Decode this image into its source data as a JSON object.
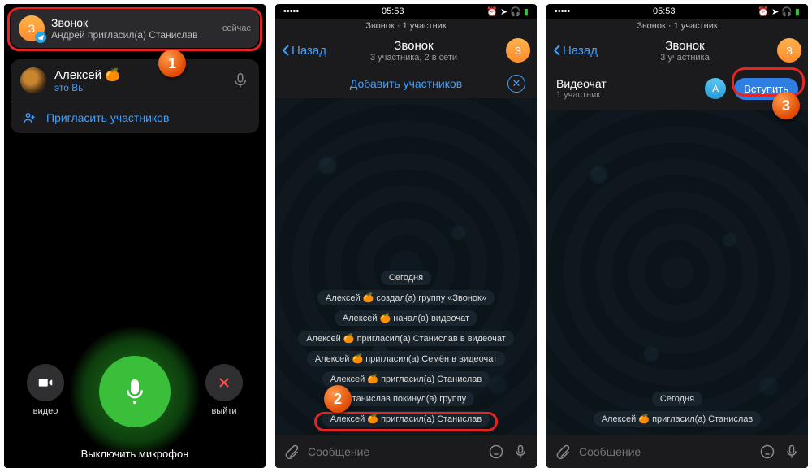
{
  "status": {
    "time": "05:53"
  },
  "screen1": {
    "notif": {
      "title": "Звонок",
      "subtitle": "Андрей пригласил(а) Станислав",
      "when": "сейчас",
      "avatar_text": "З"
    },
    "user": {
      "name": "Алексей 🍊",
      "sub": "это Вы"
    },
    "invite": "Пригласить участников",
    "video": "видео",
    "leave": "выйти",
    "mic_label": "Выключить микрофон",
    "badge": "1"
  },
  "screen2": {
    "top_sub": "Звонок · 1 участник",
    "back": "Назад",
    "title": "Звонок",
    "subtitle": "3 участника, 2 в сети",
    "avatar_text": "З",
    "add": "Добавить участников",
    "day": "Сегодня",
    "msgs": [
      "Алексей 🍊 создал(а) группу «Звонок»",
      "Алексей 🍊 начал(а) видеочат",
      "Алексей 🍊 пригласил(а) Станислав в видеочат",
      "Алексей 🍊 пригласил(а) Семён в видеочат",
      "Алексей 🍊 пригласил(а) Станислав",
      "Станислав покинул(а) группу",
      "Алексей 🍊 пригласил(а) Станислав"
    ],
    "placeholder": "Сообщение",
    "badge": "2"
  },
  "screen3": {
    "top_sub": "Звонок · 1 участник",
    "back": "Назад",
    "title": "Звонок",
    "subtitle": "3 участника",
    "avatar_text": "З",
    "join_title": "Видеочат",
    "join_sub": "1 участник",
    "join_avatar": "А",
    "join_btn": "Вступить",
    "day": "Сегодня",
    "msg": "Алексей 🍊 пригласил(а) Станислав",
    "placeholder": "Сообщение",
    "badge": "3"
  }
}
